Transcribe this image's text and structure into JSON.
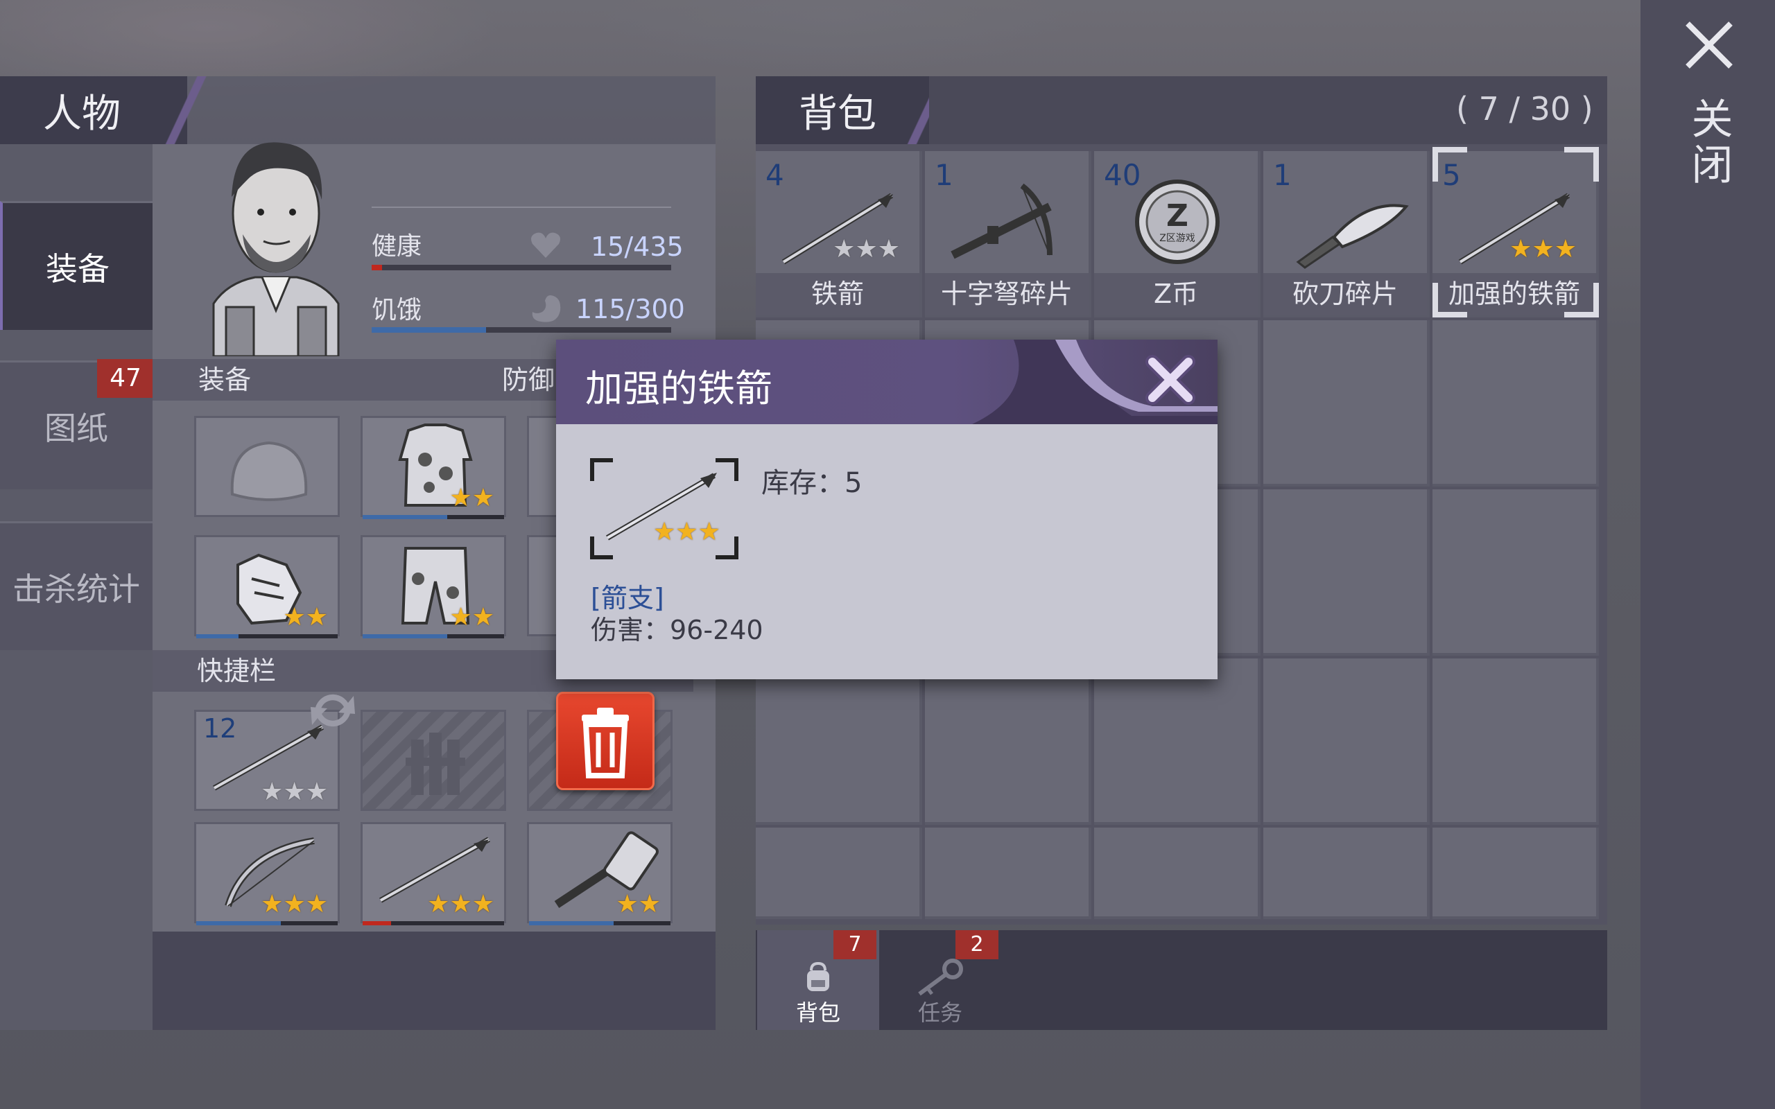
{
  "window": {
    "close_label": "关闭"
  },
  "character_panel": {
    "title": "人物",
    "side_tabs": [
      {
        "label": "装备",
        "active": true
      },
      {
        "label": "图纸",
        "badge": "47"
      },
      {
        "label": "击杀统计"
      }
    ],
    "stats": {
      "health": {
        "label": "健康",
        "value": "15/435",
        "fraction": 0.034,
        "color": "#c0281e"
      },
      "hunger": {
        "label": "饥饿",
        "value": "115/300",
        "fraction": 0.383,
        "color": "#3e6aa8"
      }
    },
    "equipment": {
      "label": "装备",
      "defense_label": "防御"
    },
    "quickbar": {
      "label": "快捷栏",
      "first_count": "12"
    }
  },
  "backpack": {
    "title": "背包",
    "capacity": "( 7 / 30 )",
    "items": [
      {
        "count": "4",
        "name": "铁箭",
        "stars": 3,
        "gold_stars": 0,
        "icon": "arrow-icon"
      },
      {
        "count": "1",
        "name": "十字弩碎片",
        "icon": "crossbow-icon"
      },
      {
        "count": "40",
        "name": "Z币",
        "icon": "coin-icon",
        "coin_text": "Z区游戏"
      },
      {
        "count": "1",
        "name": "砍刀碎片",
        "icon": "machete-icon"
      },
      {
        "count": "5",
        "name": "加强的铁箭",
        "stars": 3,
        "gold_stars": 3,
        "icon": "arrow-icon",
        "selected": true
      }
    ],
    "tabs": [
      {
        "label": "背包",
        "badge": "7",
        "active": true,
        "icon": "backpack-icon"
      },
      {
        "label": "任务",
        "badge": "2",
        "icon": "key-icon"
      }
    ]
  },
  "item_popup": {
    "title": "加强的铁箭",
    "stock": "库存：5",
    "category": "[箭支]",
    "damage": "伤害：96-240"
  },
  "colors": {
    "accent": "#5c4f7c",
    "badge": "#a0302c",
    "trash": "#d8371f"
  }
}
